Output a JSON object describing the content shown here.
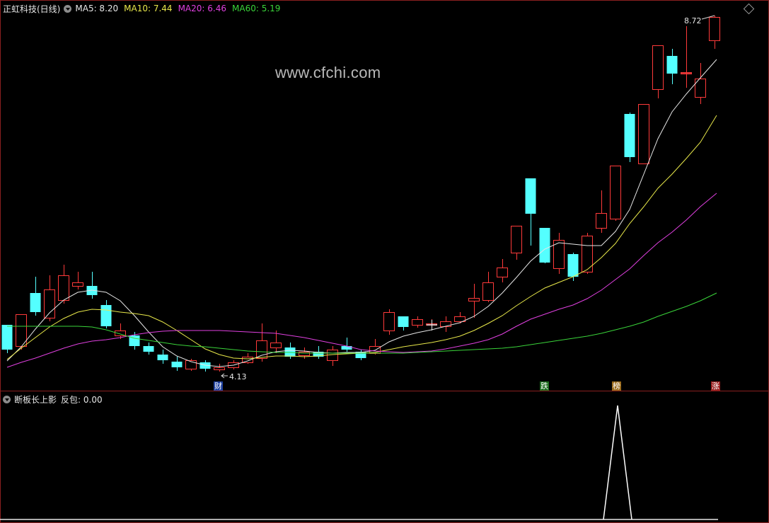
{
  "header": {
    "stock_name": "正虹科技(日线)",
    "ma_labels": [
      {
        "text": "MA5: 8.20",
        "color": "#e6e6e6"
      },
      {
        "text": "MA10: 7.44",
        "color": "#e8e84a"
      },
      {
        "text": "MA20: 6.46",
        "color": "#e040e0"
      },
      {
        "text": "MA60: 5.19",
        "color": "#3ad43a"
      }
    ]
  },
  "watermark": "www.cfchi.com",
  "annotations": {
    "high_price": "8.72",
    "low_price": "4.13"
  },
  "event_tags": {
    "cai": "财",
    "die": "跌",
    "bang": "榜",
    "zhang": "涨"
  },
  "indicator": {
    "title": "断板长上影",
    "value_label": "反包: 0.00"
  },
  "colors": {
    "up": "#ff3a3a",
    "down": "#54ffff",
    "ma5": "#e6e6e6",
    "ma10": "#e8e84a",
    "ma20": "#e040e0",
    "ma60": "#3ad43a",
    "border": "#8a1f1f"
  }
}
